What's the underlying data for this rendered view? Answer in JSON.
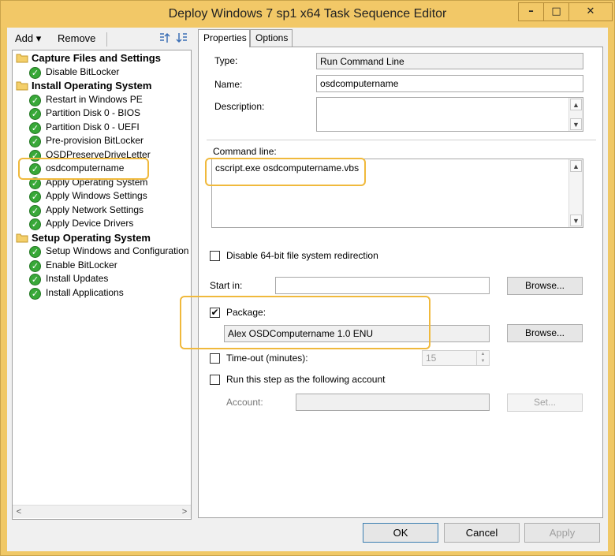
{
  "window": {
    "title": "Deploy Windows 7 sp1 x64 Task Sequence Editor",
    "minimize": "–",
    "maximize": "□",
    "close": "✕"
  },
  "toolbar": {
    "add_label": "Add ▾",
    "remove_label": "Remove",
    "icons": [
      "move-up-icon",
      "move-down-icon"
    ]
  },
  "tree": {
    "items": [
      {
        "type": "group",
        "label": "Capture Files and Settings"
      },
      {
        "type": "step",
        "label": "Disable BitLocker"
      },
      {
        "type": "group",
        "label": "Install Operating System"
      },
      {
        "type": "step",
        "label": "Restart in Windows PE"
      },
      {
        "type": "step",
        "label": "Partition Disk 0 - BIOS"
      },
      {
        "type": "step",
        "label": "Partition Disk 0 - UEFI"
      },
      {
        "type": "step",
        "label": "Pre-provision BitLocker"
      },
      {
        "type": "step",
        "label": "OSDPreserveDriveLetter"
      },
      {
        "type": "step",
        "label": "osdcomputername",
        "selected": true
      },
      {
        "type": "step",
        "label": "Apply Operating System"
      },
      {
        "type": "step",
        "label": "Apply Windows Settings"
      },
      {
        "type": "step",
        "label": "Apply Network Settings"
      },
      {
        "type": "step",
        "label": "Apply Device Drivers"
      },
      {
        "type": "group",
        "label": "Setup Operating System"
      },
      {
        "type": "step",
        "label": "Setup Windows and Configuration"
      },
      {
        "type": "step",
        "label": "Enable BitLocker"
      },
      {
        "type": "step",
        "label": "Install Updates"
      },
      {
        "type": "step",
        "label": "Install Applications"
      }
    ],
    "scroll_left": "<",
    "scroll_right": ">"
  },
  "tabs": {
    "properties": "Properties",
    "options": "Options"
  },
  "props": {
    "type_label": "Type:",
    "type_value": "Run Command Line",
    "name_label": "Name:",
    "name_value": "osdcomputername",
    "description_label": "Description:",
    "description_value": "",
    "command_line_label": "Command line:",
    "command_line_value": "cscript.exe osdcomputername.vbs",
    "disable64_label": "Disable 64-bit file system redirection",
    "disable64_checked": false,
    "start_in_label": "Start in:",
    "start_in_value": "",
    "browse_label": "Browse...",
    "package_label": "Package:",
    "package_checked": true,
    "package_value": "Alex OSDComputername 1.0 ENU",
    "timeout_label": "Time-out (minutes):",
    "timeout_value": "15",
    "run_as_label": "Run this step as the following account",
    "account_label": "Account:",
    "account_value": "",
    "set_label": "Set..."
  },
  "footer": {
    "ok": "OK",
    "cancel": "Cancel",
    "apply": "Apply"
  },
  "colors": {
    "title_bar": "#f2c867",
    "highlight": "#f0b93c",
    "check_green": "#38a838"
  }
}
